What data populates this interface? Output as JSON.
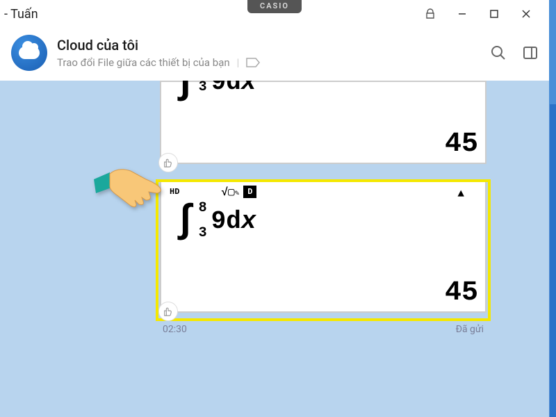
{
  "titlebar": {
    "contact_name": "- Tuấn",
    "casio_label": "CASIO"
  },
  "info": {
    "title": "Cloud của tôi",
    "subtitle": "Trao đổi File giữa các thiết bị của bạn"
  },
  "messages": [
    {
      "hd": "",
      "upper_bound": "",
      "lower_bound": "3",
      "expr_num": "9",
      "expr_dx": "dx",
      "result": "45"
    },
    {
      "hd": "HD",
      "sqrt_sym": "√▢✎",
      "upper_bound": "8",
      "lower_bound": "3",
      "expr_num": "9",
      "expr_dx": "dx",
      "result": "45"
    }
  ],
  "meta": {
    "time": "02:30",
    "status": "Đã gửi"
  },
  "icons": {
    "lock": "🔒",
    "d_label": "D",
    "triangle": "▲"
  }
}
